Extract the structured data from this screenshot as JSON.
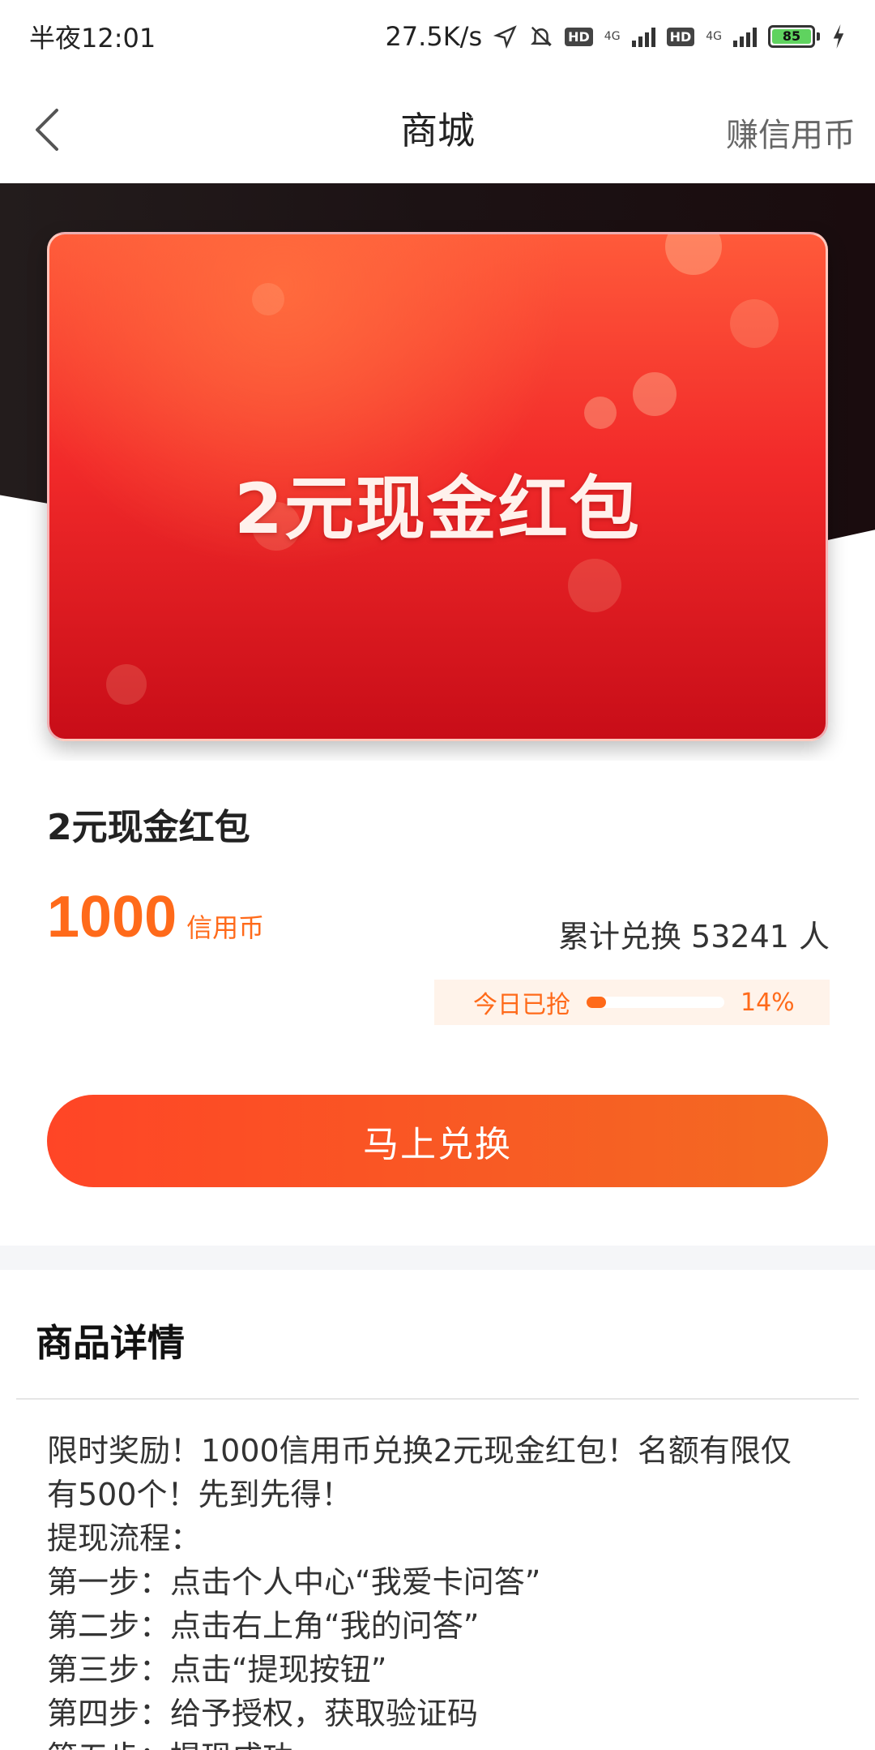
{
  "status_bar": {
    "time": "半夜12:01",
    "network_speed": "27.5K/s",
    "hd_badge": "HD",
    "net_type": "4G",
    "battery_level": "85",
    "battery_color": "#5fd35f"
  },
  "nav": {
    "title": "商城",
    "right_action": "赚信用币"
  },
  "hero": {
    "card_title": "2元现金红包"
  },
  "product": {
    "name": "2元现金红包",
    "price_value": "1000",
    "price_unit": "信用币",
    "exchange_count": "累计兑换 53241 人",
    "progress_label": "今日已抢",
    "progress_percent": "14%",
    "progress_fraction": 0.14,
    "accent_color": "#ff6a1a"
  },
  "cta": {
    "label": "马上兑换"
  },
  "details": {
    "title": "商品详情",
    "lines": [
      "限时奖励！1000信用币兑换2元现金红包！名额有限仅",
      "有500个！先到先得！",
      "提现流程：",
      "第一步：点击个人中心“我爱卡问答”",
      "第二步：点击右上角“我的问答”",
      "第三步：点击“提现按钮”",
      "第四步：给予授权，获取验证码",
      "第五步：提现成功"
    ]
  }
}
